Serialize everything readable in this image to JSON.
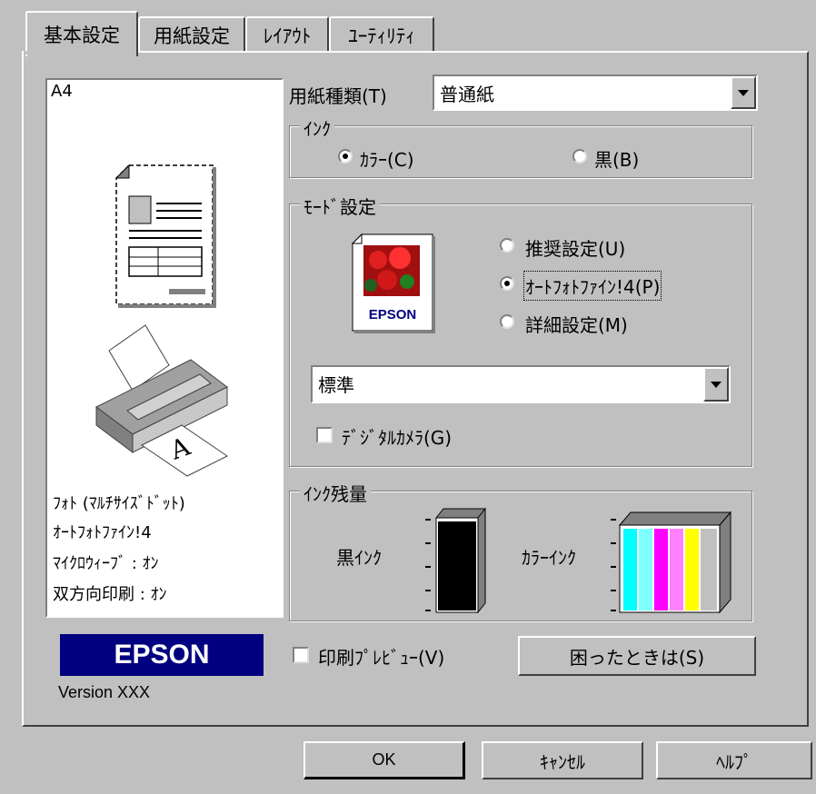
{
  "tabs": [
    {
      "label": "基本設定"
    },
    {
      "label": "用紙設定"
    },
    {
      "label": "ﾚｲｱｳﾄ"
    },
    {
      "label": "ﾕｰﾃｨﾘﾃｨ"
    }
  ],
  "preview": {
    "paper_size": "A4",
    "info_lines": [
      "ﾌｫﾄ (ﾏﾙﾁｻｲｽﾞﾄﾞｯﾄ)",
      "ｵｰﾄﾌｫﾄﾌｧｲﾝ!4",
      "ﾏｲｸﾛｳｨｰﾌﾞ : ｵﾝ",
      "双方向印刷 : ｵﾝ"
    ]
  },
  "paper_type": {
    "label": "用紙種類(T)",
    "value": "普通紙"
  },
  "ink": {
    "group_label": "ｲﾝｸ",
    "options": [
      {
        "label": "ｶﾗｰ(C)",
        "selected": true
      },
      {
        "label": "黒(B)",
        "selected": false
      }
    ]
  },
  "mode": {
    "group_label": "ﾓｰﾄﾞ設定",
    "icon_text": "EPSON",
    "options": [
      {
        "label": "推奨設定(U)",
        "selected": false
      },
      {
        "label": "ｵｰﾄﾌｫﾄﾌｧｲﾝ!4(P)",
        "selected": true
      },
      {
        "label": "詳細設定(M)",
        "selected": false
      }
    ],
    "quality_value": "標準",
    "digital_camera": {
      "label": "ﾃﾞｼﾞﾀﾙｶﾒﾗ(G)",
      "checked": false
    }
  },
  "ink_levels": {
    "group_label": "ｲﾝｸ残量",
    "black_label": "黒ｲﾝｸ",
    "color_label": "ｶﾗｰｲﾝｸ",
    "colors": [
      "#000000",
      "#00ffff",
      "#80ffff",
      "#ff00ff",
      "#ff80ff",
      "#ffff00"
    ]
  },
  "brand": {
    "logo": "EPSON",
    "version": "Version XXX",
    "logo_bg": "#000080"
  },
  "print_preview": {
    "label": "印刷ﾌﾟﾚﾋﾞｭｰ(V)",
    "checked": false
  },
  "help_button": {
    "label": "困ったときは(S)"
  },
  "footer": {
    "ok": "OK",
    "cancel": "ｷｬﾝｾﾙ",
    "help": "ﾍﾙﾌﾟ"
  }
}
